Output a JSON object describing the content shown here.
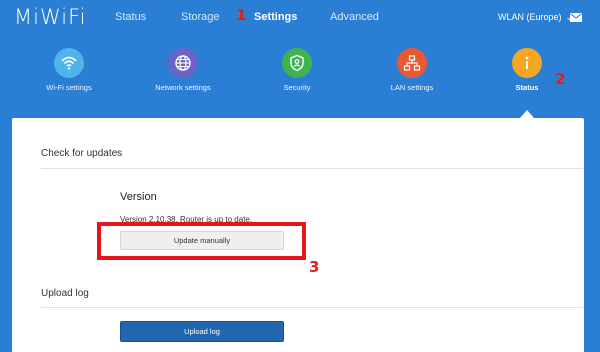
{
  "header": {
    "logo": "MiWiFi",
    "nav": [
      {
        "label": "Status",
        "active": false
      },
      {
        "label": "Storage",
        "active": false
      },
      {
        "label": "Settings",
        "active": true
      },
      {
        "label": "Advanced",
        "active": false
      }
    ],
    "wlan_label": "WLAN (Europe)",
    "chevron": "⌄"
  },
  "settings_icons": [
    {
      "label": "Wi-Fi settings",
      "icon": "wifi-icon",
      "color": "#4fb4ec"
    },
    {
      "label": "Network settings",
      "icon": "globe-icon",
      "color": "#6a63c8"
    },
    {
      "label": "Security",
      "icon": "shield-icon",
      "color": "#3fb34f"
    },
    {
      "label": "LAN settings",
      "icon": "network-icon",
      "color": "#e95a33"
    },
    {
      "label": "Status",
      "icon": "info-icon",
      "color": "#f5a623",
      "active": true
    }
  ],
  "markers": {
    "one": "1",
    "two": "2",
    "three": "3"
  },
  "updates": {
    "title": "Check for updates",
    "version_title": "Version",
    "version_text": "Version 2.10.38, Router is up to date.",
    "update_button": "Update manually"
  },
  "upload": {
    "title": "Upload log",
    "button": "Upload log"
  },
  "colors": {
    "background": "#2a7fd4",
    "highlight": "#e8141b",
    "upload_button": "#2266b0"
  }
}
